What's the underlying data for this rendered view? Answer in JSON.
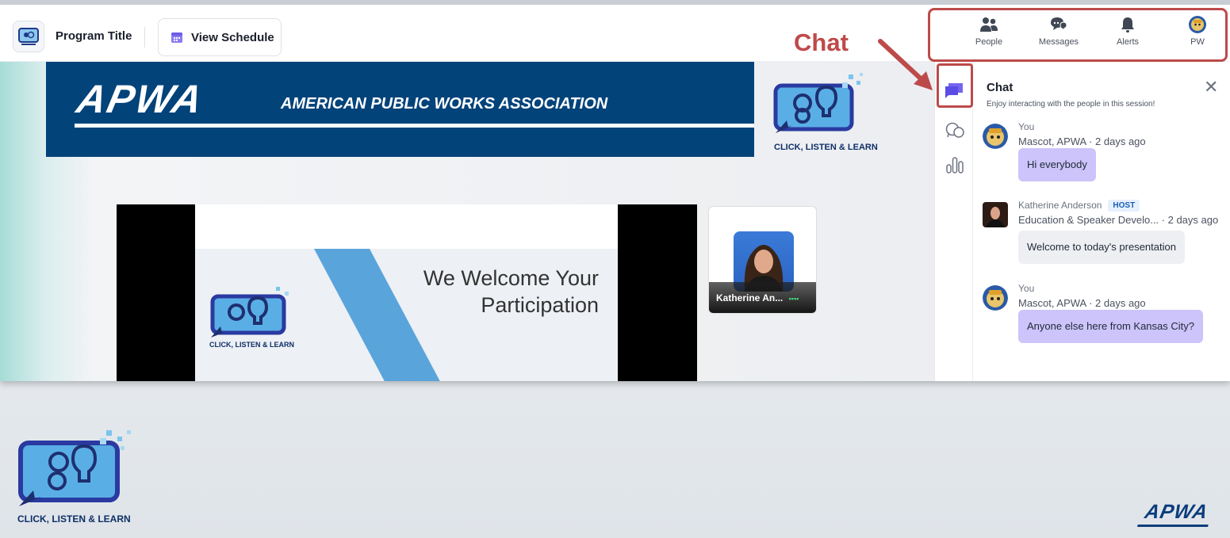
{
  "header": {
    "program_title": "Program Title",
    "view_schedule_label": "View Schedule",
    "nav": [
      {
        "label": "People",
        "icon": "people-icon"
      },
      {
        "label": "Messages",
        "icon": "messages-icon"
      },
      {
        "label": "Alerts",
        "icon": "bell-icon"
      },
      {
        "label": "PW",
        "icon": "profile-avatar"
      }
    ]
  },
  "annotation": {
    "label": "Chat",
    "color": "#bd4a4a"
  },
  "stage": {
    "banner_logo": "APWA",
    "banner_text": "AMERICAN PUBLIC WORKS ASSOCIATION",
    "badge_text": "CLICK, LISTEN & LEARN",
    "slide_line1": "We Welcome Your",
    "slide_line2": "Participation",
    "speaker_name": "Katherine An..."
  },
  "rail": {
    "icons": [
      "chat-icon",
      "qa-icon",
      "polls-icon"
    ],
    "accent": "#5b4ce6"
  },
  "chat": {
    "title": "Chat",
    "subtitle": "Enjoy interacting with the people in this session!",
    "messages": [
      {
        "who": "You",
        "meta": "Mascot, APWA  · 2 days ago",
        "text": "Hi everybody"
      },
      {
        "who": "Katherine Anderson",
        "badge": "HOST",
        "meta": "Education & Speaker Develo...  · 2 days ago",
        "text": "Welcome to today's presentation"
      },
      {
        "who": "You",
        "meta": "Mascot, APWA  · 2 days ago",
        "text": "Anyone else here from Kansas City?"
      }
    ]
  },
  "footer": {
    "badge_text": "CLICK, LISTEN & LEARN",
    "logo_text": "APWA"
  }
}
